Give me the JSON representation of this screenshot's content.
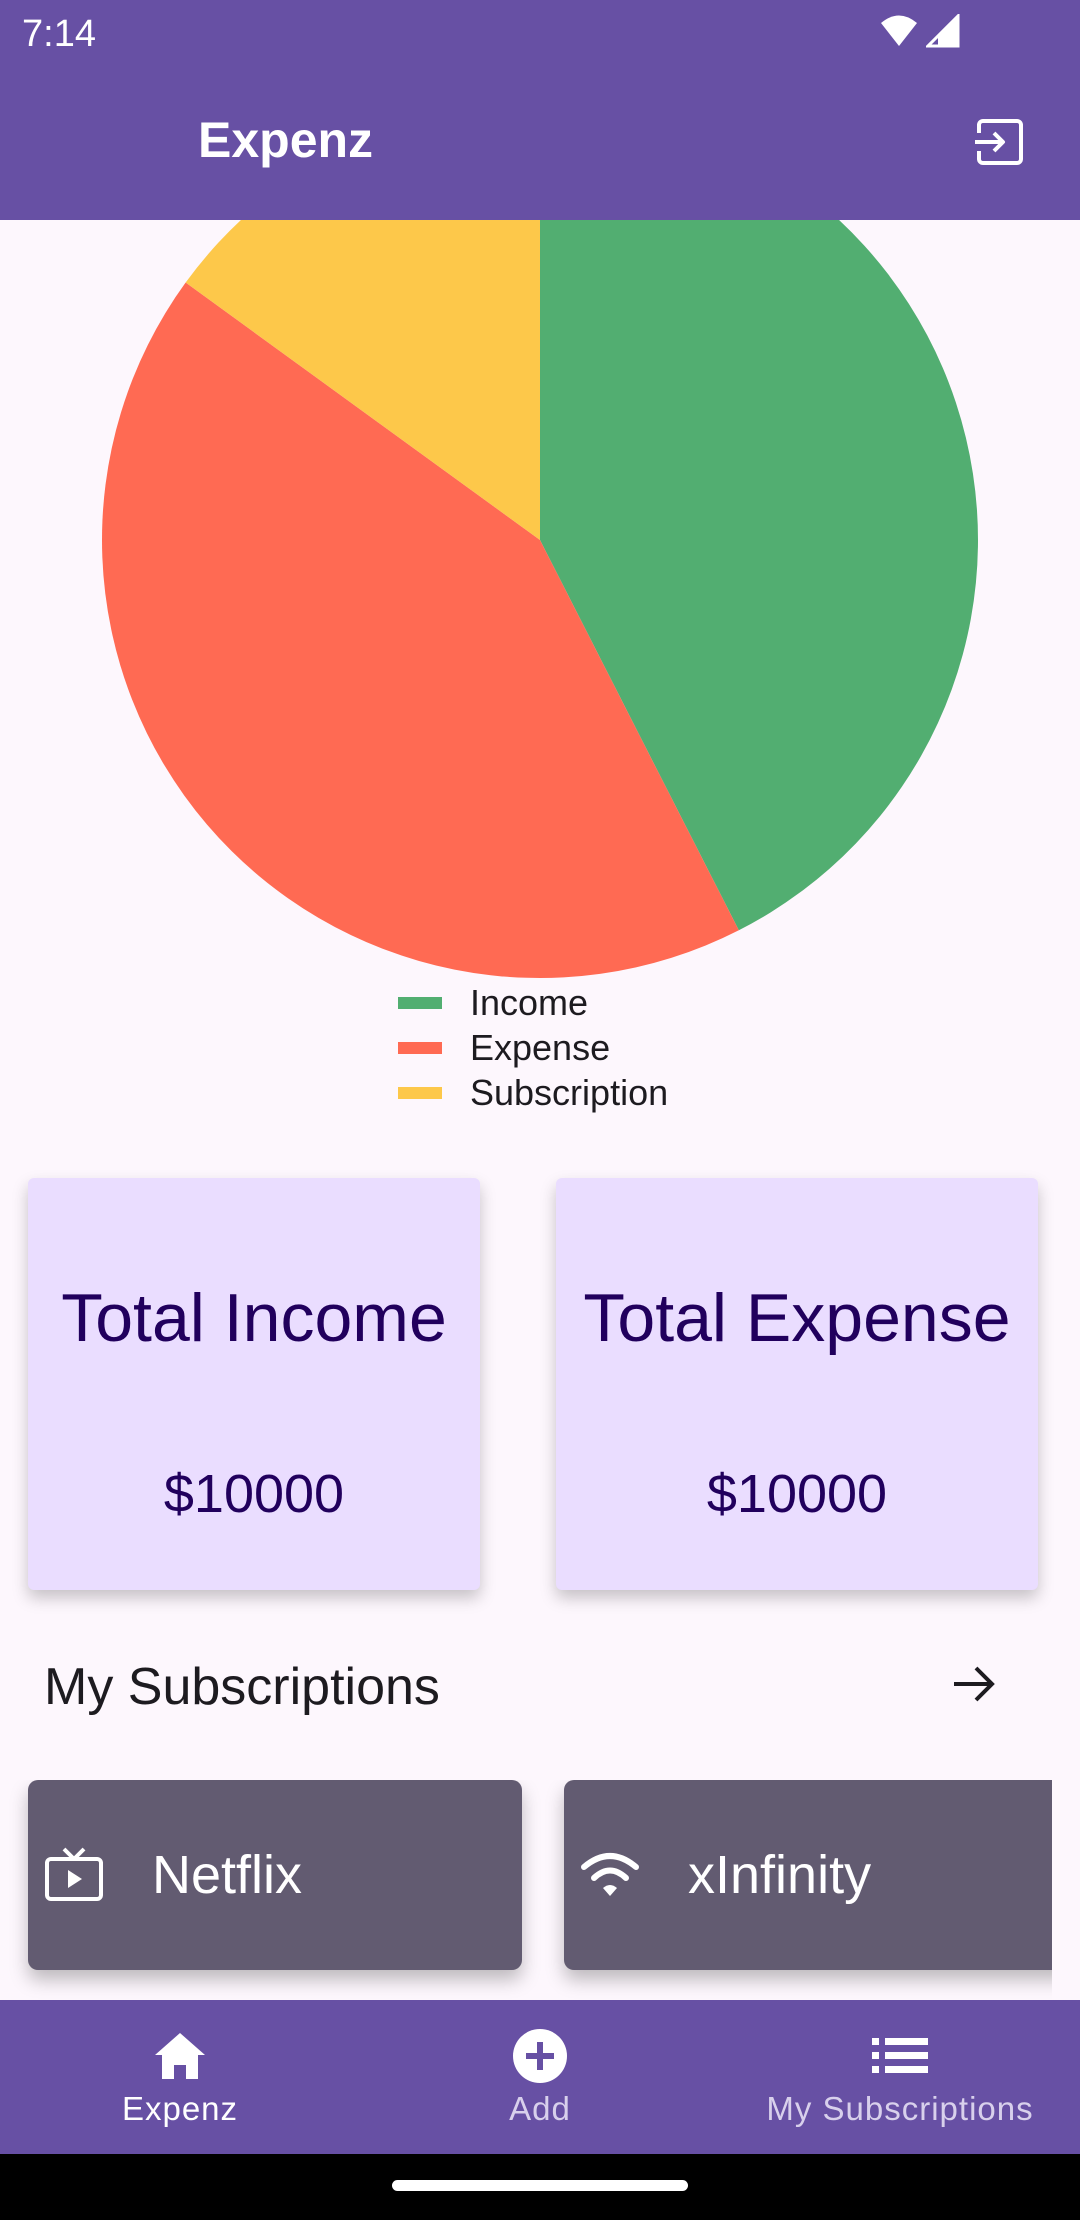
{
  "status_bar": {
    "time": "7:14",
    "icons": [
      "wifi-icon",
      "signal-icon"
    ]
  },
  "app_bar": {
    "title": "Expenz",
    "action_icon": "logout-icon"
  },
  "chart_data": {
    "type": "pie",
    "title": "",
    "labels": [
      "Income",
      "Expense",
      "Subscription"
    ],
    "values": [
      42.5,
      42.5,
      15
    ],
    "colors": [
      "#52ae71",
      "#ff6a53",
      "#fdc84a"
    ],
    "legend": "bottom-center"
  },
  "summary": {
    "income": {
      "title": "Total Income",
      "value": "$10000"
    },
    "expense": {
      "title": "Total Expense",
      "value": "$10000"
    }
  },
  "subscriptions": {
    "header": "My Subscriptions",
    "arrow_icon": "arrow-right-icon",
    "items": [
      {
        "name": "Netflix",
        "icon": "tv-icon"
      },
      {
        "name": "xInfinity",
        "icon": "wifi-icon"
      }
    ]
  },
  "bottom_nav": {
    "items": [
      {
        "label": "Expenz",
        "icon": "home-icon",
        "active": true
      },
      {
        "label": "Add",
        "icon": "add-circle-icon",
        "active": false
      },
      {
        "label": "My Subscriptions",
        "icon": "list-icon",
        "active": false
      }
    ]
  },
  "colors": {
    "primary": "#6750a4",
    "card_bg": "#eaddff",
    "card_text": "#21005d",
    "tile_bg": "#625b71",
    "page_bg": "#fdf7fd"
  }
}
